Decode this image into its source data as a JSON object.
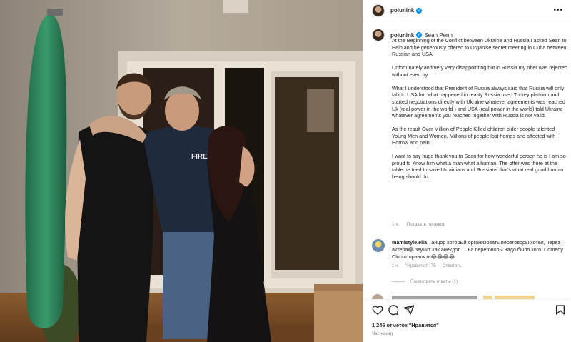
{
  "post": {
    "username": "polunink",
    "mention": "Sean Penn",
    "caption": [
      "At the Beginning of the Conflict between Ukraine and Russia I asked Sean to Help and he generously offered to Organise secret meeting in Cuba between Russian and USA.",
      "Unfortunately and very very disappointing but in Russia my offer was rejected without even try.",
      "What I understood that President of Russia always said that Russia will only talk to USA but what happened in reality Russia used Turkey platform and started negotiations directly with Ukraine whatever agreements was reached Uk (real power in the world ) and USA (real power in the world) told Ukraine whatever agreements you reached together with Russia is not valid.",
      "As the result Over Million of People Killed children older people talented Young Men and Women. Millions of people lost homes and affected with Horrow and pain.",
      "I want to say huge thank you to Sean for how wonderful person he is I am so proud to Know him what a man what a human. The offer was there at the table he tried to save Ukrainians and Russians that's what real good human being should do."
    ],
    "time_ago": "1 ч.",
    "translate_label": "Показать перевод",
    "likes": "1 246 отметок \"Нравится\"",
    "posted": "Час назад",
    "more_icon": "more-horizontal-icon"
  },
  "comment": {
    "username": "mamistyle.ella",
    "text": "Танцор который организовать переговоры хотел, через актера😂 звучит как анекдот..... на переговоры надо было кого. Comedy Club отправлять😂😂😂😂",
    "time_ago": "1 ч.",
    "likes_label": "\"Нравится\": 75",
    "reply_label": "Ответить",
    "view_replies": "Посмотреть ответы (1)"
  },
  "colors": {
    "verified": "#0095f6",
    "text": "#262626",
    "muted": "#8e8e8e",
    "border": "#efefef"
  },
  "icons": [
    "heart-icon",
    "comment-icon",
    "share-icon",
    "bookmark-icon",
    "verified-badge-icon"
  ]
}
